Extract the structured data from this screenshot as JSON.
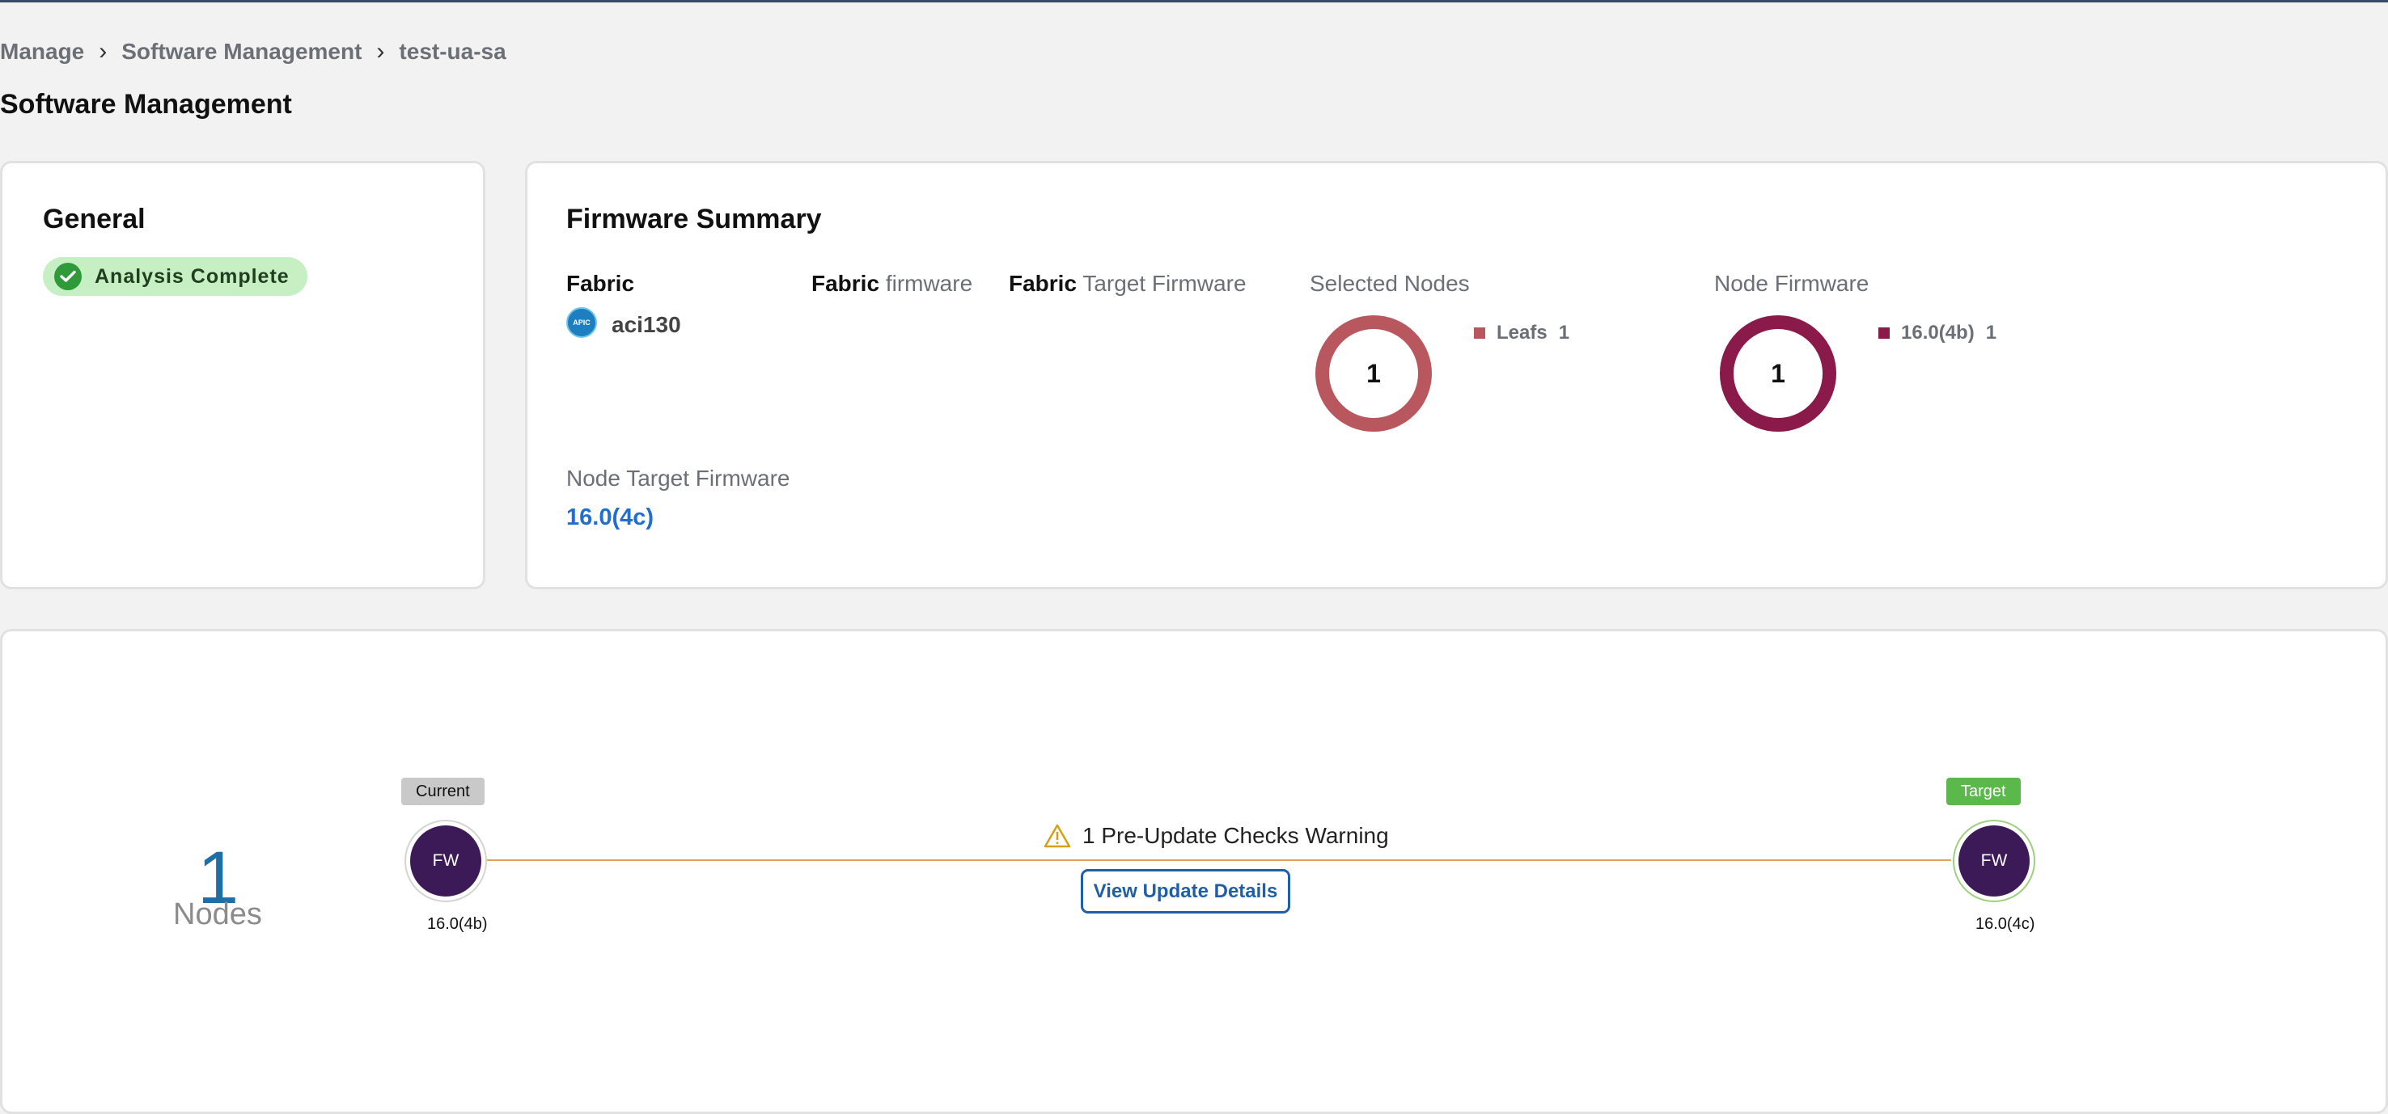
{
  "breadcrumb": {
    "items": [
      "Manage",
      "Software Management",
      "test-ua-sa"
    ],
    "separator": "›"
  },
  "page_title": "Software Management",
  "general": {
    "title": "General",
    "status": "Analysis Complete",
    "status_color": "#2e9a3a"
  },
  "firmware_summary": {
    "title": "Firmware Summary",
    "fabric": {
      "label": "Fabric",
      "value": "aci130",
      "logo_text": "APIC"
    },
    "fabric_firmware": {
      "label_bold": "Fabric",
      "label": "firmware"
    },
    "fabric_target_firmware": {
      "label_bold": "Fabric",
      "label": "Target Firmware"
    },
    "selected_nodes": {
      "label": "Selected Nodes",
      "total": "1",
      "legend": [
        {
          "name": "Leafs",
          "count": "1",
          "color": "#b9575f"
        }
      ]
    },
    "node_firmware": {
      "label": "Node Firmware",
      "total": "1",
      "legend": [
        {
          "name": "16.0(4b)",
          "count": "1",
          "color": "#8a1a4a"
        }
      ]
    },
    "node_target_firmware": {
      "label": "Node Target Firmware",
      "value": "16.0(4c)"
    }
  },
  "update": {
    "nodes_count": "1",
    "nodes_label": "Nodes",
    "current": {
      "tag": "Current",
      "icon_text": "FW",
      "version": "16.0(4b)"
    },
    "target": {
      "tag": "Target",
      "icon_text": "FW",
      "version": "16.0(4c)"
    },
    "warning": "1 Pre-Update Checks Warning",
    "view_button": "View Update Details",
    "line_color": "#e2a257"
  }
}
